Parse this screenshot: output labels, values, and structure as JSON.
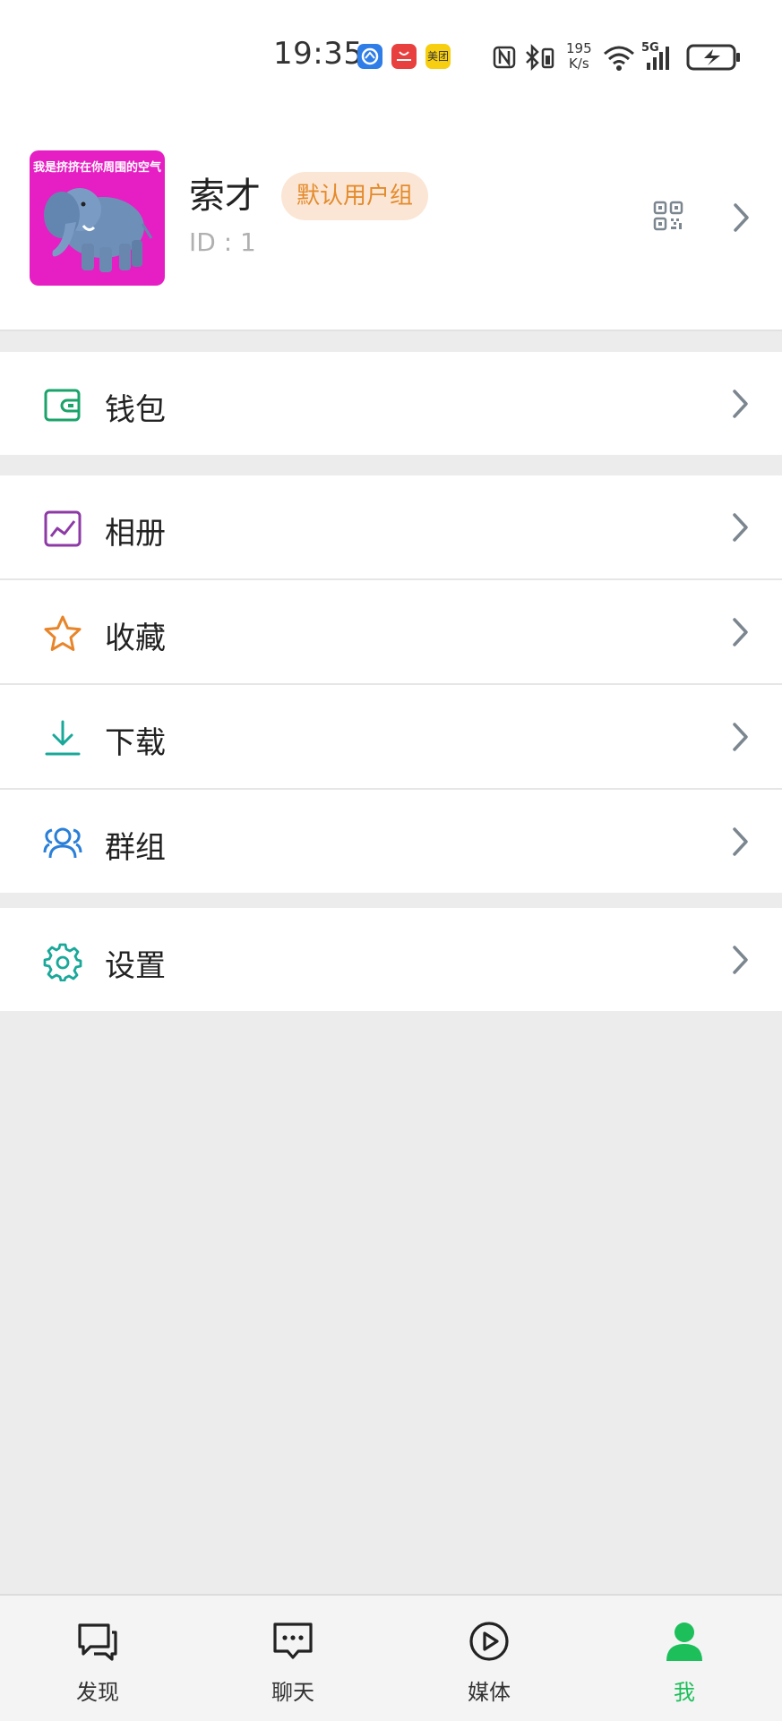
{
  "status_bar": {
    "time": "19:35",
    "speed_top": "195",
    "speed_bottom": "K/s",
    "network": "5G",
    "apps": [
      "huawei-browser-icon",
      "huawei-appgallery-icon",
      "meituan-icon"
    ],
    "meituan_label": "美团"
  },
  "profile": {
    "name": "索才",
    "badge": "默认用户组",
    "id_text": "ID : 1",
    "avatar_caption": "我是挤挤在你周围的空气"
  },
  "menu_groups": [
    [
      {
        "label": "钱包",
        "icon": "wallet-icon",
        "color": "#1aa36a"
      }
    ],
    [
      {
        "label": "相册",
        "icon": "album-icon",
        "color": "#8e3aa6"
      },
      {
        "label": "收藏",
        "icon": "star-icon",
        "color": "#e8852a"
      },
      {
        "label": "下载",
        "icon": "download-icon",
        "color": "#1aa89a"
      },
      {
        "label": "群组",
        "icon": "group-icon",
        "color": "#2a7fd8"
      }
    ],
    [
      {
        "label": "设置",
        "icon": "settings-gear-icon",
        "color": "#1aa89a"
      }
    ]
  ],
  "tabbar": {
    "tabs": [
      {
        "label": "发现",
        "icon": "chat-bubbles-icon",
        "active": false
      },
      {
        "label": "聊天",
        "icon": "message-dots-icon",
        "active": false
      },
      {
        "label": "媒体",
        "icon": "play-circle-icon",
        "active": false
      },
      {
        "label": "我",
        "icon": "person-icon",
        "active": true
      }
    ],
    "active_color": "#1dbf5b"
  }
}
